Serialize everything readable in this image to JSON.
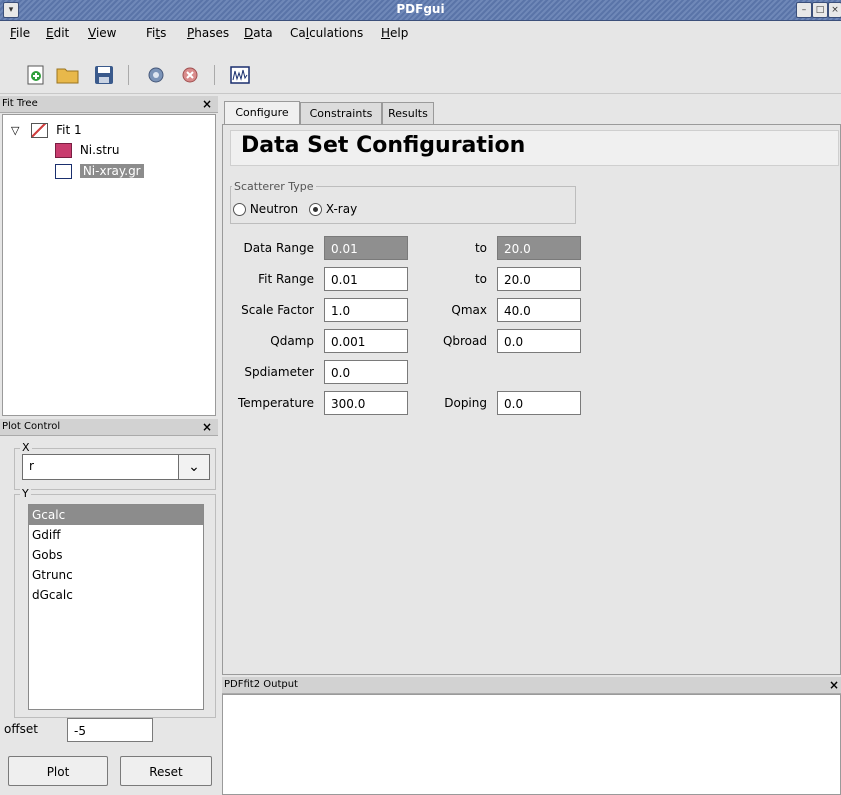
{
  "window": {
    "title": "PDFgui"
  },
  "menu": [
    {
      "label": "File",
      "u": "F",
      "rest": "ile"
    },
    {
      "label": "Edit",
      "u": "E",
      "rest": "dit"
    },
    {
      "label": "View",
      "u": "V",
      "rest": "iew"
    },
    {
      "label": "Fits",
      "pre": "Fi",
      "u": "t",
      "rest": "s"
    },
    {
      "label": "Phases",
      "u": "P",
      "rest": "hases"
    },
    {
      "label": "Data",
      "u": "D",
      "rest": "ata"
    },
    {
      "label": "Calculations",
      "pre": "Ca",
      "u": "l",
      "rest": "culations"
    },
    {
      "label": "Help",
      "u": "H",
      "rest": "elp"
    }
  ],
  "fit_tree": {
    "header": "Fit Tree",
    "fit": "Fit 1",
    "phase": "Ni.stru",
    "dataset": "Ni-xray.gr"
  },
  "plot_control": {
    "header": "Plot Control",
    "x_label": "X",
    "x_value": "r",
    "y_label": "Y",
    "y_items": [
      "Gcalc",
      "Gdiff",
      "Gobs",
      "Gtrunc",
      "dGcalc"
    ],
    "offset_label": "offset",
    "offset_value": "-5",
    "plot_button": "Plot",
    "reset_button": "Reset"
  },
  "tabs": [
    "Configure",
    "Constraints",
    "Results"
  ],
  "config": {
    "title": "Data Set Configuration",
    "scatterer_label": "Scatterer Type",
    "neutron": "Neutron",
    "xray": "X-ray",
    "data_range_label": "Data Range",
    "data_range_from": "0.01",
    "data_range_to": "20.0",
    "fit_range_label": "Fit Range",
    "fit_range_from": "0.01",
    "fit_range_to": "20.0",
    "to_label": "to",
    "scale_label": "Scale Factor",
    "scale_value": "1.0",
    "qmax_label": "Qmax",
    "qmax_value": "40.0",
    "qdamp_label": "Qdamp",
    "qdamp_value": "0.001",
    "qbroad_label": "Qbroad",
    "qbroad_value": "0.0",
    "spdiameter_label": "Spdiameter",
    "spdiameter_value": "0.0",
    "temperature_label": "Temperature",
    "temperature_value": "300.0",
    "doping_label": "Doping",
    "doping_value": "0.0"
  },
  "output": {
    "header": "PDFfit2 Output"
  }
}
